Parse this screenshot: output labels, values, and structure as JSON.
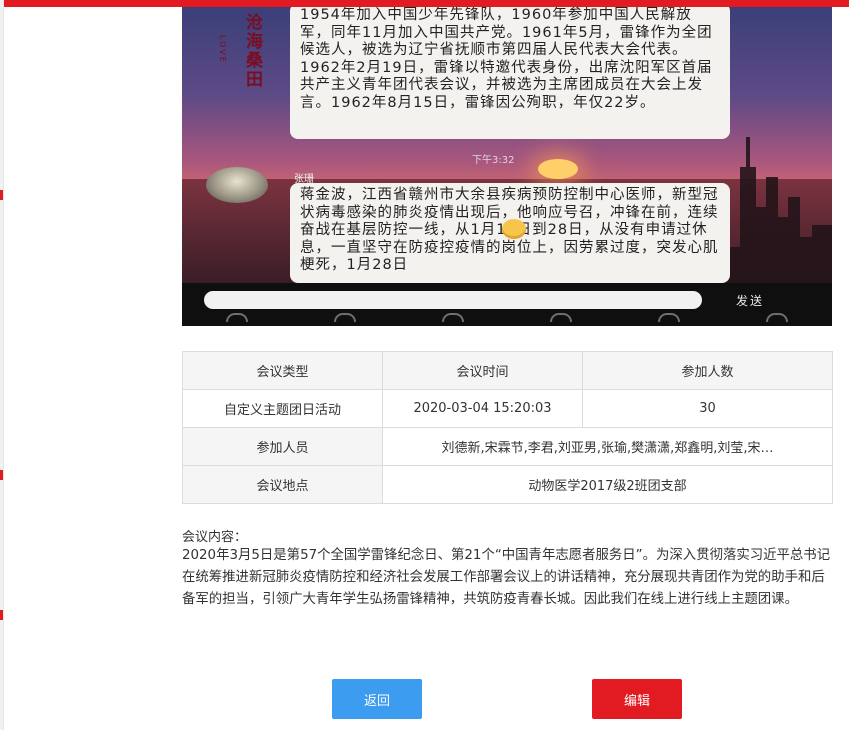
{
  "theme": {
    "accent": "#e21b23",
    "back_button_color": "#3c9cf0",
    "edit_button_color": "#e21b23"
  },
  "photo": {
    "poem_text": "沧海桑田",
    "poem_sub": "LOVE",
    "bubble1_text": "1954年加入中国少年先锋队，1960年参加中国人民解放军，同年11月加入中国共产党。1961年5月，雷锋作为全团候选人，被选为辽宁省抚顺市第四届人民代表大会代表。1962年2月19日，雷锋以特邀代表身份，出席沈阳军区首届共产主义青年团代表会议，并被选为主席团成员在大会上发言。1962年8月15日，雷锋因公殉职，年仅22岁。",
    "chat_time": "下午3:32",
    "sender_name": "张珊",
    "bubble2_text": "蒋金波，江西省赣州市大余县疾病预防控制中心医师，新型冠状病毒感染的肺炎疫情出现后，他响应号召，冲锋在前，连续奋战在基层防控一线，从1月15日到28日，从没有申请过休息，一直坚守在防疫控疫情的岗位上，因劳累过度，突发心肌梗死，1月28日",
    "send_label": "发送"
  },
  "table": {
    "headers": [
      "会议类型",
      "会议时间",
      "参加人数"
    ],
    "row1": [
      "自定义主题团日活动",
      "2020-03-04 15:20:03",
      "30"
    ],
    "participants_label": "参加人员",
    "participants_value": "刘德新,宋霖节,李君,刘亚男,张瑜,樊潇潇,郑鑫明,刘莹,宋…",
    "location_label": "会议地点",
    "location_value": "动物医学2017级2班团支部"
  },
  "content": {
    "label": "会议内容：",
    "body": "2020年3月5日是第57个全国学雷锋纪念日、第21个“中国青年志愿者服务日”。为深入贯彻落实习近平总书记在统筹推进新冠肺炎疫情防控和经济社会发展工作部署会议上的讲话精神，充分展现共青团作为党的助手和后备军的担当，引领广大青年学生弘扬雷锋精神，共筑防疫青春长城。因此我们在线上进行线上主题团课。"
  },
  "buttons": {
    "back": "返回",
    "edit": "编辑"
  }
}
